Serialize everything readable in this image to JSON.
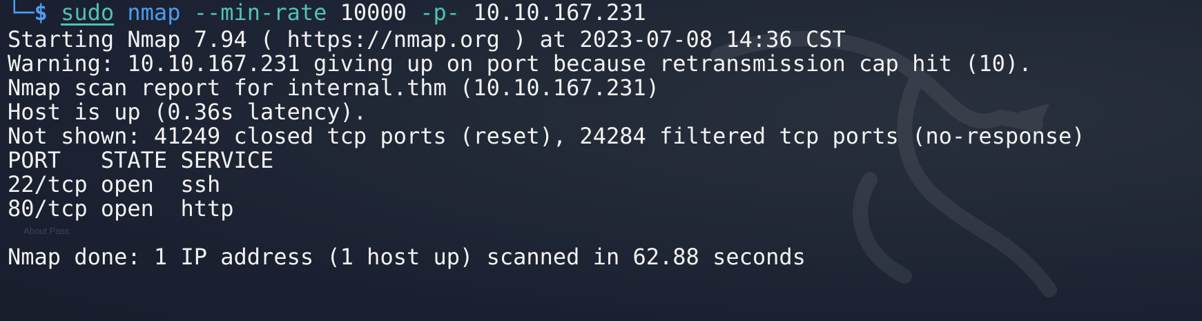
{
  "terminal": {
    "background_color": "#1e2533",
    "prompt": {
      "corner": "└─",
      "symbol": "$",
      "sudo": "sudo",
      "binary": "nmap",
      "flag_rate": "--min-rate",
      "rate_value": "10000",
      "flag_ports": "-p-",
      "target": "10.10.167.231"
    },
    "output_lines": [
      "Starting Nmap 7.94 ( https://nmap.org ) at 2023-07-08 14:36 CST",
      "Warning: 10.10.167.231 giving up on port because retransmission cap hit (10).",
      "Nmap scan report for internal.thm (10.10.167.231)",
      "Host is up (0.36s latency).",
      "Not shown: 41249 closed tcp ports (reset), 24284 filtered tcp ports (no-response)",
      "PORT   STATE SERVICE",
      "22/tcp open  ssh",
      "80/tcp open  http",
      "",
      "Nmap done: 1 IP address (1 host up) scanned in 62.88 seconds"
    ],
    "background_ghost_text": "About Pass"
  }
}
